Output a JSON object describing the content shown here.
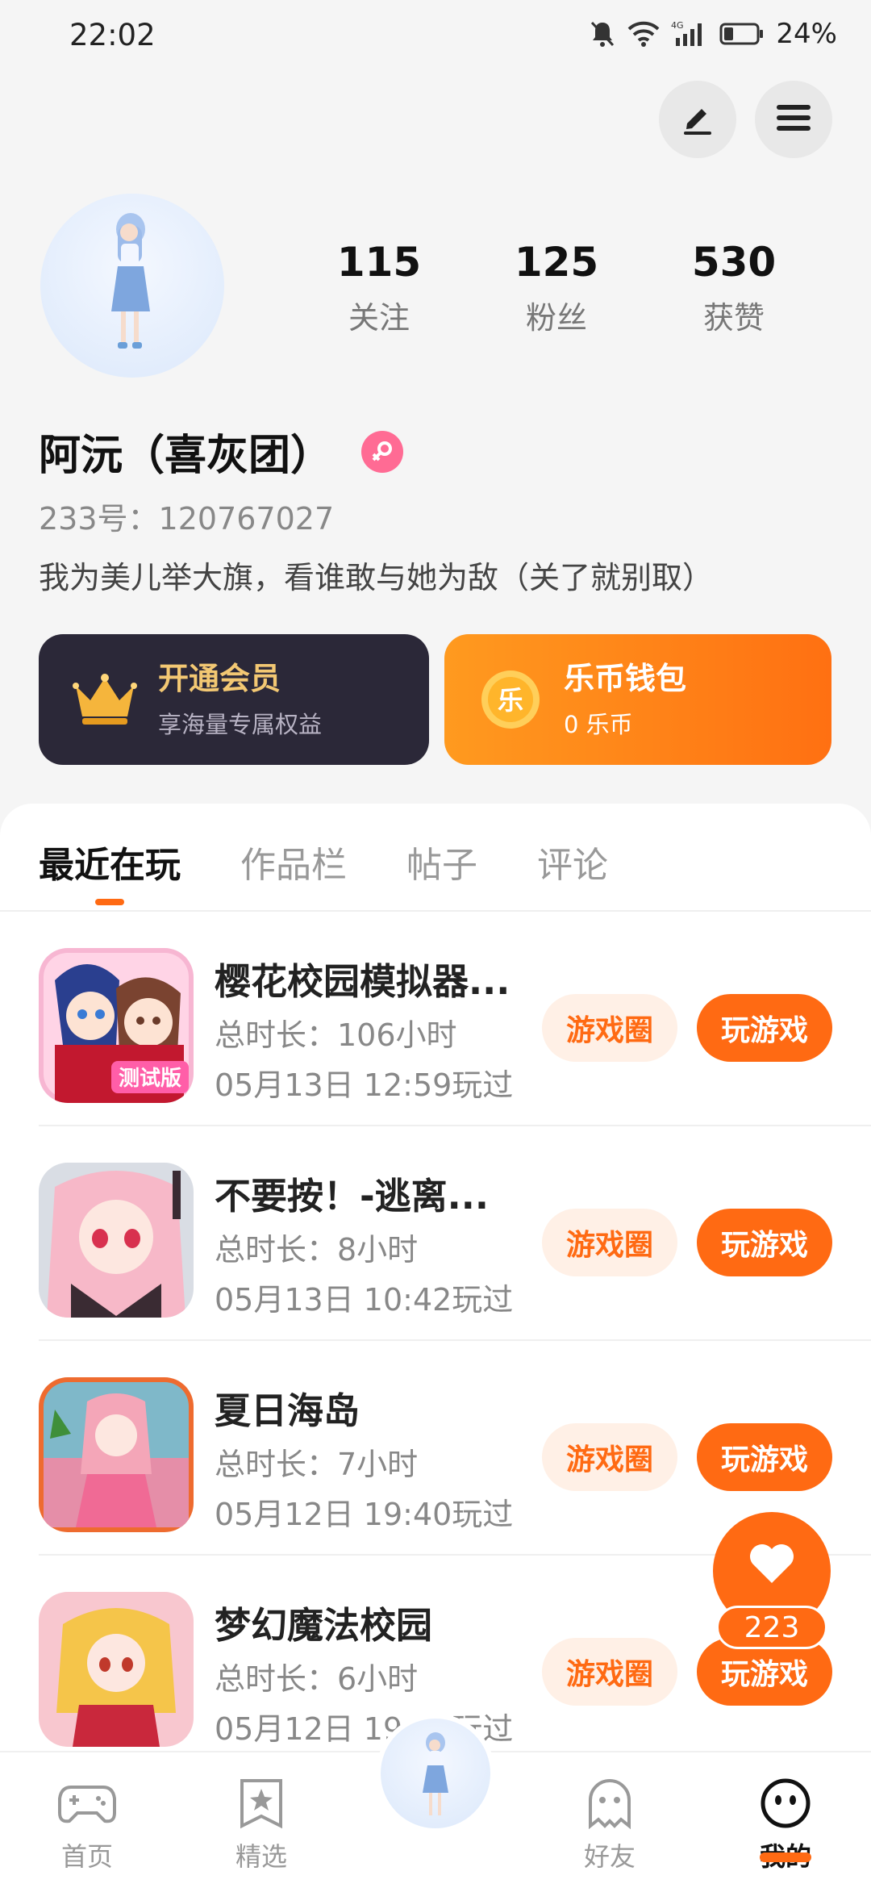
{
  "status_bar": {
    "time": "22:02",
    "battery": "24%",
    "network": "4G"
  },
  "header": {
    "edit_icon": "pencil-icon",
    "menu_icon": "hamburger-icon"
  },
  "profile": {
    "stats": [
      {
        "num": "115",
        "label": "关注"
      },
      {
        "num": "125",
        "label": "粉丝"
      },
      {
        "num": "530",
        "label": "获赞"
      }
    ],
    "name": "阿沅（喜灰团）",
    "id": "233号：120767027",
    "bio": "我为美儿举大旗，看谁敢与她为敌（关了就别取）"
  },
  "cards": {
    "vip": {
      "title": "开通会员",
      "sub": "享海量专属权益"
    },
    "wallet": {
      "title": "乐币钱包",
      "sub": "0 乐币",
      "coin_char": "乐"
    }
  },
  "tabs": [
    "最近在玩",
    "作品栏",
    "帖子",
    "评论"
  ],
  "games": [
    {
      "title": "樱花校园模拟器...",
      "duration": "总时长：106小时",
      "last": "05月13日 12:59玩过",
      "icon_text": "测试版"
    },
    {
      "title": "不要按！-逃离...",
      "duration": "总时长：8小时",
      "last": "05月13日 10:42玩过",
      "icon_text": ""
    },
    {
      "title": "夏日海岛",
      "duration": "总时长：7小时",
      "last": "05月12日 19:40玩过",
      "icon_text": ""
    },
    {
      "title": "梦幻魔法校园",
      "duration": "总时长：6小时",
      "last": "05月12日 19:19玩过",
      "icon_text": ""
    }
  ],
  "game_buttons": {
    "circle": "游戏圈",
    "play": "玩游戏"
  },
  "float_like": {
    "count": "223"
  },
  "bottom_nav": [
    {
      "label": "首页",
      "icon": "gamepad-icon"
    },
    {
      "label": "精选",
      "icon": "star-badge-icon"
    },
    {
      "label": "好友",
      "icon": "ghost-icon"
    },
    {
      "label": "我的",
      "icon": "smile-face-icon"
    }
  ],
  "colors": {
    "accent": "#ff6a13",
    "vip_bg": "#2b2838",
    "vip_gold": "#f3c873",
    "female": "#ff6b94"
  }
}
